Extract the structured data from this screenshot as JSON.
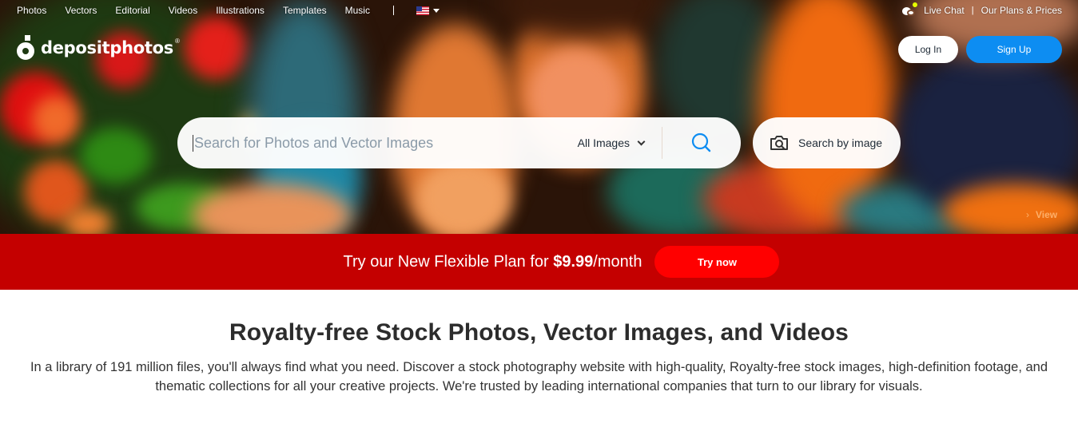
{
  "topnav": {
    "items": [
      "Photos",
      "Vectors",
      "Editorial",
      "Videos",
      "Illustrations",
      "Templates",
      "Music"
    ],
    "language_icon": "us-flag-icon"
  },
  "brand": {
    "name": "depositphotos",
    "registered": "®"
  },
  "account": {
    "live_chat": "Live Chat",
    "separator": "|",
    "plans": "Our Plans & Prices",
    "login": "Log In",
    "signup": "Sign Up"
  },
  "search": {
    "placeholder": "Search for Photos and Vector Images",
    "value": "",
    "type_selected": "All Images",
    "image_search_label": "Search by image"
  },
  "hero": {
    "view_label": "View"
  },
  "promo": {
    "prefix": "Try our New Flexible Plan for ",
    "price": "$9.99",
    "suffix": "/month",
    "cta": "Try now"
  },
  "intro": {
    "heading": "Royalty-free Stock Photos, Vector Images, and Videos",
    "body": "In a library of 191 million files, you'll always find what you need. Discover a stock photography website with high-quality, Royalty-free stock images, high-definition footage, and thematic collections for all your creative projects. We're trusted by leading international companies that turn to our library for visuals."
  },
  "colors": {
    "accent_blue": "#0d8df2",
    "promo_bg": "#c40000",
    "promo_cta": "#ff0000",
    "heading_text": "#2c2c2c"
  }
}
